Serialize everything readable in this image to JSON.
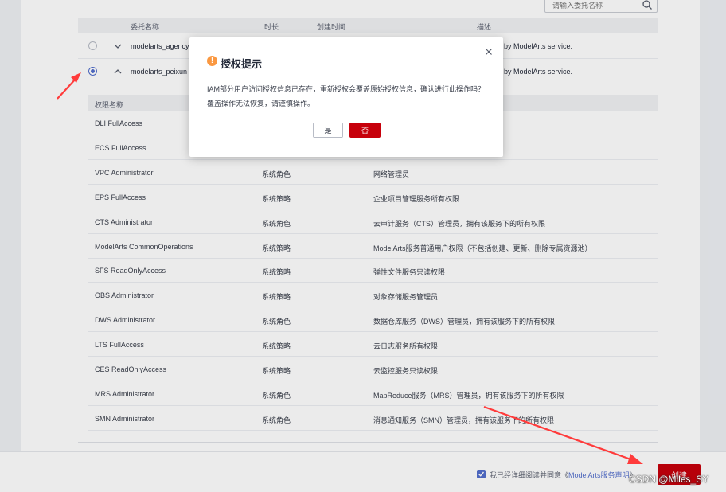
{
  "search": {
    "placeholder": "请输入委托名称",
    "icon": "search-icon"
  },
  "table": {
    "headers": {
      "name": "委托名称",
      "duration": "时长",
      "created": "创建时间",
      "description": "描述"
    },
    "rows": [
      {
        "name": "modelarts_agency",
        "description": "by ModelArts service.",
        "selected": false,
        "expanded": false
      },
      {
        "name": "modelarts_peixun",
        "description": "by ModelArts service.",
        "selected": true,
        "expanded": true
      }
    ]
  },
  "permissions": {
    "header": "权限名称",
    "rows": [
      {
        "name": "DLI FullAccess",
        "type": "",
        "desc": ""
      },
      {
        "name": "ECS FullAccess",
        "type": "",
        "desc": ""
      },
      {
        "name": "VPC Administrator",
        "type": "系统角色",
        "desc": "网络管理员"
      },
      {
        "name": "EPS FullAccess",
        "type": "系统策略",
        "desc": "企业项目管理服务所有权限"
      },
      {
        "name": "CTS Administrator",
        "type": "系统角色",
        "desc": "云审计服务（CTS）管理员，拥有该服务下的所有权限"
      },
      {
        "name": "ModelArts CommonOperations",
        "type": "系统策略",
        "desc": "ModelArts服务普通用户权限（不包括创建、更新、删除专属资源池）"
      },
      {
        "name": "SFS ReadOnlyAccess",
        "type": "系统策略",
        "desc": "弹性文件服务只读权限"
      },
      {
        "name": "OBS Administrator",
        "type": "系统策略",
        "desc": "对象存储服务管理员"
      },
      {
        "name": "DWS Administrator",
        "type": "系统角色",
        "desc": "数据仓库服务（DWS）管理员，拥有该服务下的所有权限"
      },
      {
        "name": "LTS FullAccess",
        "type": "系统策略",
        "desc": "云日志服务所有权限"
      },
      {
        "name": "CES ReadOnlyAccess",
        "type": "系统策略",
        "desc": "云监控服务只读权限"
      },
      {
        "name": "MRS Administrator",
        "type": "系统角色",
        "desc": "MapReduce服务（MRS）管理员，拥有该服务下的所有权限"
      },
      {
        "name": "SMN Administrator",
        "type": "系统角色",
        "desc": "消息通知服务（SMN）管理员，拥有该服务下的所有权限"
      }
    ]
  },
  "footer": {
    "agree_text": "我已经详细阅读并同意《",
    "agree_link": "ModelArts服务声明",
    "agree_end": "》",
    "agree_checked": true,
    "create_label": "创建"
  },
  "dialog": {
    "title": "授权提示",
    "message1": "IAM部分用户访问授权信息已存在，重新授权会覆盖原始授权信息，确认进行此操作吗？",
    "message2": "覆盖操作无法恢复，请谨慎操作。",
    "yes_label": "是",
    "no_label": "否",
    "warn_glyph": "!"
  },
  "watermark": "CSDN @Miles_SY",
  "colors": {
    "accent": "#526ecc",
    "primary_button": "#c7000b",
    "annotation_arrow": "#ff3b3b"
  }
}
